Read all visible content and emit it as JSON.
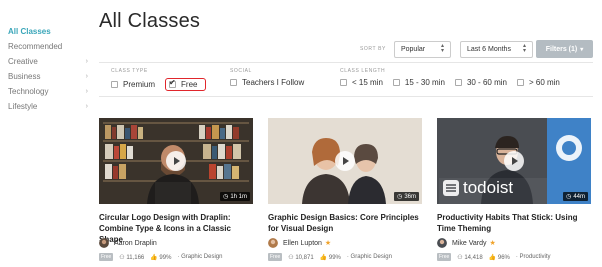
{
  "sidebar": {
    "items": [
      {
        "label": "All Classes",
        "active": true,
        "chevron": false
      },
      {
        "label": "Recommended",
        "active": false,
        "chevron": false
      },
      {
        "label": "Creative",
        "active": false,
        "chevron": true
      },
      {
        "label": "Business",
        "active": false,
        "chevron": true
      },
      {
        "label": "Technology",
        "active": false,
        "chevron": true
      },
      {
        "label": "Lifestyle",
        "active": false,
        "chevron": true
      }
    ]
  },
  "page_title": "All Classes",
  "toolbar": {
    "sort_label": "SORT BY",
    "sort_value": "Popular",
    "time_value": "Last 6 Months",
    "filters_label": "Filters (1)"
  },
  "filters": {
    "class_type": {
      "heading": "CLASS TYPE",
      "options": [
        {
          "label": "Premium",
          "checked": false
        },
        {
          "label": "Free",
          "checked": true
        }
      ]
    },
    "social": {
      "heading": "SOCIAL",
      "options": [
        {
          "label": "Teachers I Follow",
          "checked": false
        }
      ]
    },
    "length": {
      "heading": "CLASS LENGTH",
      "options": [
        {
          "label": "< 15 min",
          "checked": false
        },
        {
          "label": "15 - 30 min",
          "checked": false
        },
        {
          "label": "30 - 60 min",
          "checked": false
        },
        {
          "label": "> 60 min",
          "checked": false
        }
      ]
    }
  },
  "cards": [
    {
      "title": "Circular Logo Design with Draplin: Combine Type & Icons in a Classic Shape",
      "duration": "1h 1m",
      "author": "Aaron Draplin",
      "star": false,
      "badge": "Free",
      "students": "11,166",
      "rating": "99%",
      "category": "Graphic Design"
    },
    {
      "title": "Graphic Design Basics: Core Principles for Visual Design",
      "duration": "36m",
      "author": "Ellen Lupton",
      "star": true,
      "badge": "Free",
      "students": "10,871",
      "rating": "99%",
      "category": "Graphic Design"
    },
    {
      "title": "Productivity Habits That Stick: Using Time Theming",
      "duration": "44m",
      "author": "Mike Vardy",
      "star": true,
      "badge": "Free",
      "students": "14,418",
      "rating": "96%",
      "category": "Productivity",
      "thumb_logo": "todoist"
    }
  ],
  "colors": {
    "accent": "#3aa6b9",
    "highlight_box": "#e0262c",
    "filters_button": "#b4bcc2",
    "star": "#f0a32b",
    "todoist_blue": "#3f82c7"
  }
}
